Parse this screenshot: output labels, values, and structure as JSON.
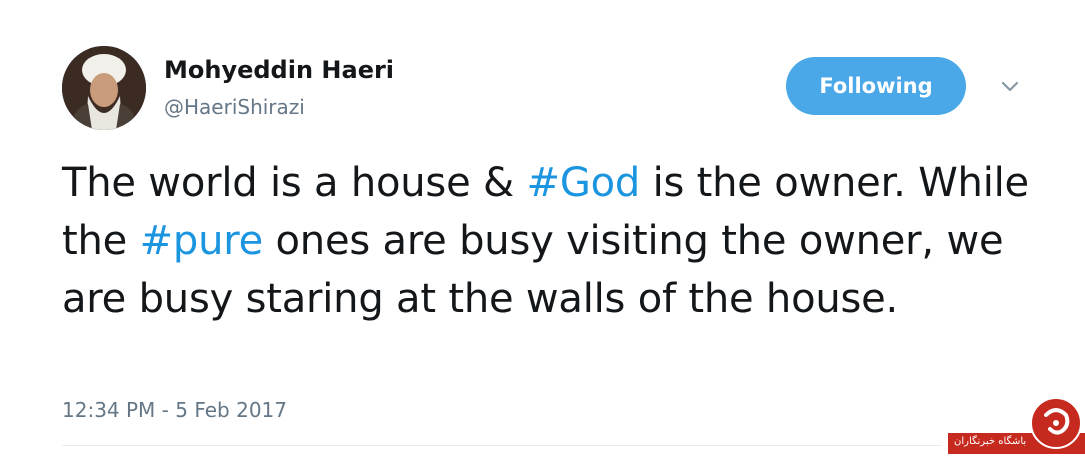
{
  "profile": {
    "display_name": "Mohyeddin Haeri",
    "handle": "@HaeriShirazi",
    "avatar_icon": "profile-photo"
  },
  "actions": {
    "follow_label": "Following",
    "menu_icon": "chevron-down-icon"
  },
  "tweet": {
    "part1": "The world is a house & ",
    "hashtag1": "#God",
    "part2": " is the owner. While the ",
    "hashtag2": "#pure",
    "part3": " ones are busy visiting the owner, we are busy staring at the walls of the house.",
    "timestamp": "12:34 PM - 5 Feb 2017"
  },
  "watermark": {
    "text": "باشگاه خبرنگاران"
  },
  "colors": {
    "accent": "#1b95e0",
    "button": "#4aa8e8",
    "secondary_text": "#657786",
    "watermark": "#c62a1f"
  }
}
